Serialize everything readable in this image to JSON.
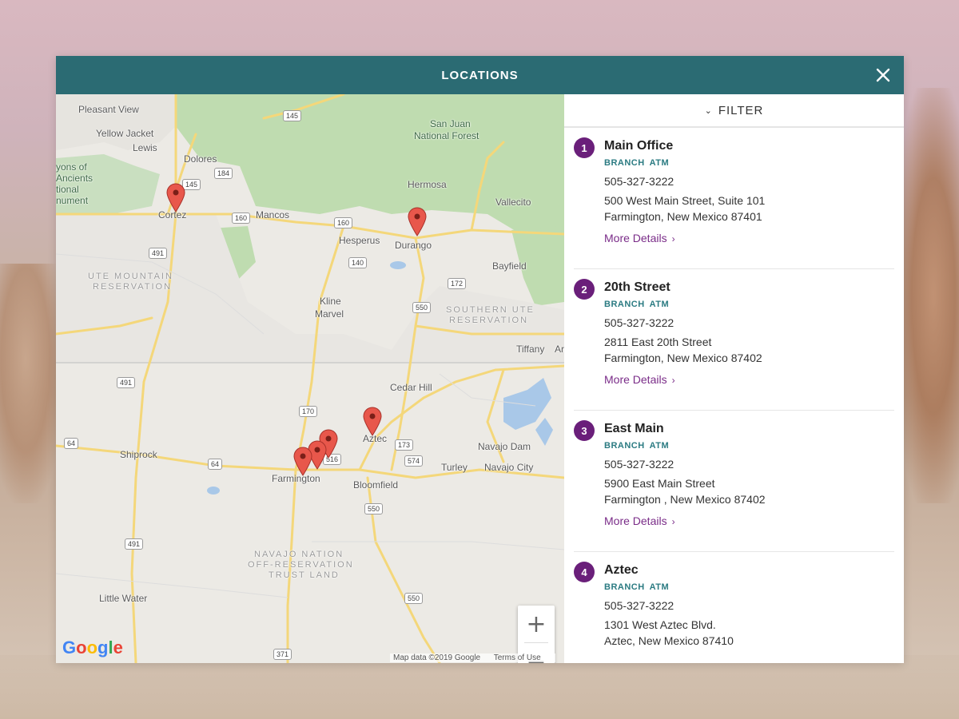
{
  "header": {
    "title": "LOCATIONS",
    "close_icon": "close-icon"
  },
  "filter": {
    "label": "FILTER",
    "icon": "chevron-down-icon"
  },
  "locations": [
    {
      "num": "1",
      "name": "Main Office",
      "tags": [
        "BRANCH",
        "ATM"
      ],
      "phone": "505-327-3222",
      "address1": "500 West Main Street, Suite 101",
      "address2": "Farmington, New Mexico 87401",
      "more": "More Details"
    },
    {
      "num": "2",
      "name": "20th Street",
      "tags": [
        "BRANCH",
        "ATM"
      ],
      "phone": "505-327-3222",
      "address1": "2811 East 20th Street",
      "address2": "Farmington, New Mexico 87402",
      "more": "More Details"
    },
    {
      "num": "3",
      "name": "East Main",
      "tags": [
        "BRANCH",
        "ATM"
      ],
      "phone": "505-327-3222",
      "address1": "5900 East Main Street",
      "address2": "Farmington , New Mexico 87402",
      "more": "More Details"
    },
    {
      "num": "4",
      "name": "Aztec",
      "tags": [
        "BRANCH",
        "ATM"
      ],
      "phone": "505-327-3222",
      "address1": "1301 West Aztec Blvd.",
      "address2": "Aztec, New Mexico 87410",
      "more": "More Details"
    }
  ],
  "map": {
    "places": {
      "pleasant_view": "Pleasant View",
      "yellow_jacket": "Yellow Jacket",
      "lewis": "Lewis",
      "dolores": "Dolores",
      "canyons1": "yons of",
      "canyons2": "Ancients",
      "canyons3": "tional",
      "canyons4": "nument",
      "cortez": "Cortez",
      "mancos": "Mancos",
      "hesperus": "Hesperus",
      "durango": "Durango",
      "san_juan1": "San Juan",
      "san_juan2": "National Forest",
      "hermosa": "Hermosa",
      "vallecito": "Vallecito",
      "bayfield": "Bayfield",
      "ute1": "UTE MOUNTAIN",
      "ute2": "RESERVATION",
      "kline": "Kline",
      "marvel": "Marvel",
      "southern_ute1": "SOUTHERN UTE",
      "southern_ute2": "RESERVATION",
      "tiffany": "Tiffany",
      "ar": "Ar",
      "cedar_hill": "Cedar Hill",
      "aztec": "Aztec",
      "navajo_dam": "Navajo Dam",
      "shiprock": "Shiprock",
      "turley": "Turley",
      "navajo_city": "Navajo City",
      "farmington": "Farmington",
      "bloomfield": "Bloomfield",
      "navajo1": "NAVAJO NATION",
      "navajo2": "OFF-RESERVATION",
      "navajo3": "TRUST LAND",
      "little_water": "Little Water"
    },
    "shields": {
      "s145a": "145",
      "s145b": "145",
      "s184": "184",
      "s160a": "160",
      "s160b": "160",
      "s491a": "491",
      "s491b": "491",
      "s491c": "491",
      "s140": "140",
      "s172": "172",
      "s550a": "550",
      "s550b": "550",
      "s550c": "550",
      "s170": "170",
      "s173": "173",
      "s574": "574",
      "s516": "516",
      "s64a": "64",
      "s64b": "64",
      "s371": "371"
    },
    "zoom_in": "+",
    "zoom_out": "−",
    "attribution": "Map data ©2019 Google",
    "terms": "Terms of Use",
    "google": [
      "G",
      "o",
      "o",
      "g",
      "l",
      "e"
    ]
  },
  "colors": {
    "header": "#2b6b73",
    "number_badge": "#6a1f7a",
    "tag": "#2b7b82",
    "link": "#7a2c88",
    "pin": "#e8574b"
  }
}
